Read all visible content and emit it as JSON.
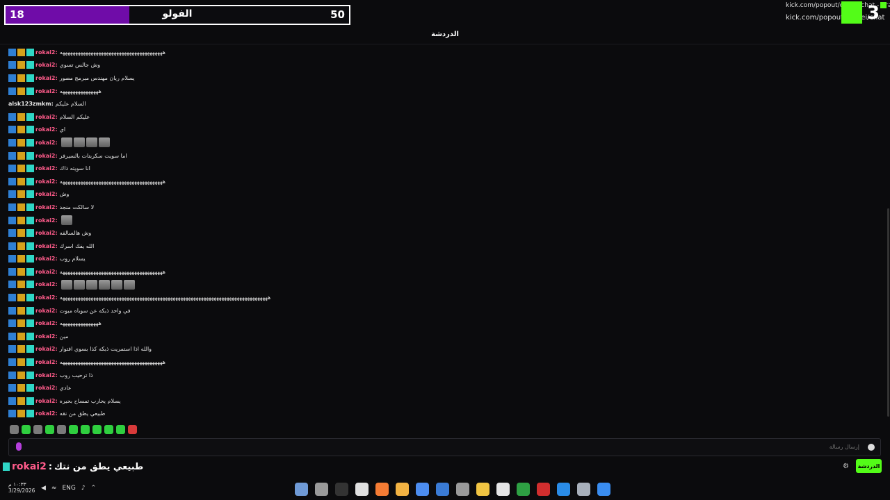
{
  "progress": {
    "current": "18",
    "label": "الفولو",
    "goal": "50",
    "fraction": 0.36,
    "fill_color": "#6f0ca8"
  },
  "browser": {
    "url_top": "kick.com/popout/cenrei/chat - Brave",
    "url_bottom": "kick.com/popout/cenrei/chat",
    "kick_digit": "3"
  },
  "chat": {
    "title": "الدردشة",
    "messages": [
      {
        "user": "rokai2:",
        "badges": true,
        "text": "ههههههههههههههههههههههههههههههههههههههههه"
      },
      {
        "user": "rokai2:",
        "badges": true,
        "text": "وش جالس تسوي"
      },
      {
        "user": "rokai2:",
        "badges": true,
        "text": "يسلام ريان مهندس مبرمج مصور"
      },
      {
        "user": "rokai2:",
        "badges": true,
        "text": "هههههههههههههههه"
      },
      {
        "user": "alsk123zmkm:",
        "badges": false,
        "text": "السلام عليكم"
      },
      {
        "user": "rokai2:",
        "badges": true,
        "text": "عليكم السلام"
      },
      {
        "user": "rokai2:",
        "badges": true,
        "text": "اي"
      },
      {
        "user": "rokai2:",
        "badges": true,
        "text": "",
        "emotes": 4
      },
      {
        "user": "rokai2:",
        "badges": true,
        "text": "اما سويت سكربتات بالسيرفر"
      },
      {
        "user": "rokai2:",
        "badges": true,
        "text": "انا سويته ذاك"
      },
      {
        "user": "rokai2:",
        "badges": true,
        "text": "ههههههههههههههههههههههههههههههههههههههههه"
      },
      {
        "user": "rokai2:",
        "badges": true,
        "text": "وش"
      },
      {
        "user": "rokai2:",
        "badges": true,
        "text": "لا سالكت منجد"
      },
      {
        "user": "rokai2:",
        "badges": true,
        "text": "",
        "emotes": 1
      },
      {
        "user": "rokai2:",
        "badges": true,
        "text": "وش هالسالفه"
      },
      {
        "user": "rokai2:",
        "badges": true,
        "text": "الله يفك اسرك"
      },
      {
        "user": "rokai2:",
        "badges": true,
        "text": "يسلام روب"
      },
      {
        "user": "rokai2:",
        "badges": true,
        "text": "ههههههههههههههههههههههههههههههههههههههههه"
      },
      {
        "user": "rokai2:",
        "badges": true,
        "text": "",
        "emotes": 6
      },
      {
        "user": "rokai2:",
        "badges": true,
        "text": "هههههههههههههههههههههههههههههههههههههههههههههههههههههههههههههههههههههههههههههههههه"
      },
      {
        "user": "rokai2:",
        "badges": true,
        "text": "في واحد ذبكه عن سوباه مبوت"
      },
      {
        "user": "rokai2:",
        "badges": true,
        "text": "هههههههههههههههه"
      },
      {
        "user": "rokai2:",
        "badges": true,
        "text": "مين"
      },
      {
        "user": "rokai2:",
        "badges": true,
        "text": "والله اذا استمريت ذبكه كذا بسوي افتوار"
      },
      {
        "user": "rokai2:",
        "badges": true,
        "text": "ههههههههههههههههههههههههههههههههههههههههه"
      },
      {
        "user": "rokai2:",
        "badges": true,
        "text": "ذا ترحيب روب"
      },
      {
        "user": "rokai2:",
        "badges": true,
        "text": "عادي"
      },
      {
        "user": "rokai2:",
        "badges": true,
        "text": "يسلام يحارب تمساح بحيره"
      },
      {
        "user": "rokai2:",
        "badges": true,
        "text": "طبيعي يطق من نقه"
      }
    ],
    "input_placeholder": "إرسال رسالة",
    "send_button": "الدردشة"
  },
  "overlay": {
    "user": "rokai2",
    "separator": ":",
    "text": "طبيعي يطق من نتك"
  },
  "emote_bar": [
    "gray",
    "green",
    "gray",
    "green",
    "gray",
    "green",
    "green",
    "green",
    "green",
    "green",
    "red"
  ],
  "taskbar": {
    "time": "١٠:٣٣ م",
    "date": "3/29/2026",
    "lang": "ENG",
    "apps": [
      "#6f9ad6",
      "#9a9a9a",
      "#333",
      "#e0e0e0",
      "#f57c34",
      "#f3b343",
      "#4c8df0",
      "#3a7bd5",
      "#9a9a9a",
      "#f1c543",
      "#e6e6e6",
      "#2ea043",
      "#d12e2e",
      "#2a8ce8",
      "#a8b0bb",
      "#3a8df0"
    ]
  },
  "colors": {
    "kick_green": "#53fc18",
    "username": "#ff5b8a"
  }
}
